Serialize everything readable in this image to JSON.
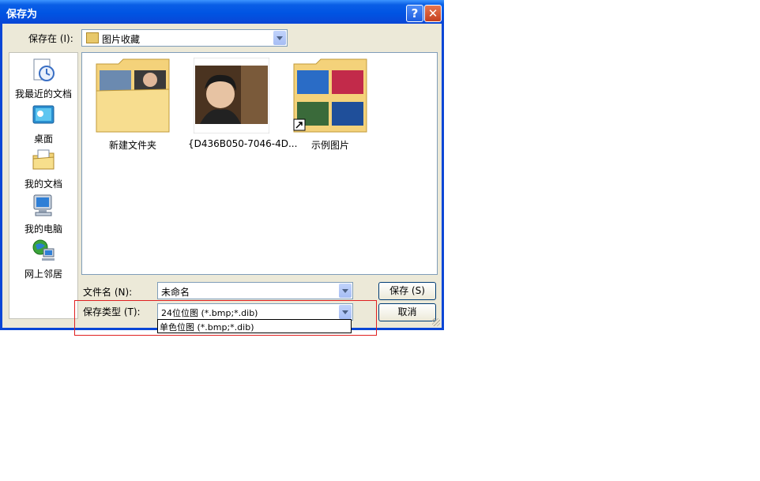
{
  "window": {
    "title": "保存为",
    "help_glyph": "?",
    "close_glyph": "✕"
  },
  "location": {
    "label": "保存在 (I):",
    "value": "图片收藏"
  },
  "toolbar": {
    "icons": [
      "back-icon",
      "up-folder-icon",
      "new-folder-icon",
      "view-menu-icon"
    ]
  },
  "places": [
    {
      "label": "我最近的文档",
      "icon": "recent-documents-icon"
    },
    {
      "label": "桌面",
      "icon": "desktop-icon"
    },
    {
      "label": "我的文档",
      "icon": "my-documents-icon"
    },
    {
      "label": "我的电脑",
      "icon": "my-computer-icon"
    },
    {
      "label": "网上邻居",
      "icon": "network-places-icon"
    }
  ],
  "files": [
    {
      "name": "新建文件夹",
      "kind": "folder"
    },
    {
      "name": "{D436B050-7046-4D...",
      "kind": "photo"
    },
    {
      "name": "示例图片",
      "kind": "shortcut-folder"
    }
  ],
  "filename": {
    "label": "文件名 (N):",
    "value": "未命名"
  },
  "filetype": {
    "label": "保存类型 (T):",
    "value": "24位位图 (*.bmp;*.dib)",
    "dropdown_option": "单色位图 (*.bmp;*.dib)"
  },
  "buttons": {
    "save": "保存 (S)",
    "cancel": "取消"
  },
  "colors": {
    "titlebar": "#0054e3",
    "dialog_bg": "#ece9d8",
    "highlight_box": "#e02020"
  }
}
